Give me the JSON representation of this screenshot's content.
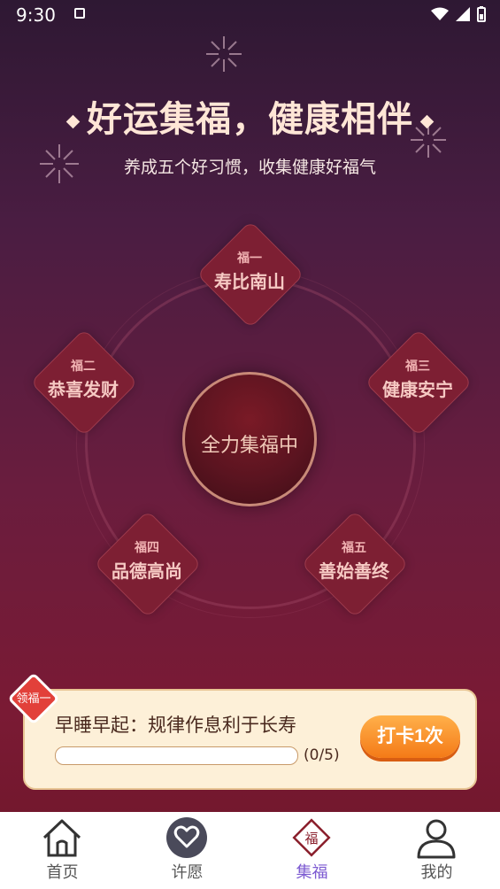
{
  "status_bar": {
    "time": "9:30"
  },
  "header": {
    "title": "好运集福，健康相伴",
    "subtitle": "养成五个好习惯，收集健康好福气"
  },
  "fu_cards": [
    {
      "num": "福一",
      "name": "寿比南山"
    },
    {
      "num": "福二",
      "name": "恭喜发财"
    },
    {
      "num": "福三",
      "name": "健康安宁"
    },
    {
      "num": "福四",
      "name": "品德高尚"
    },
    {
      "num": "福五",
      "name": "善始善终"
    }
  ],
  "center_button": {
    "label": "全力集福中"
  },
  "task": {
    "tag": "领福一",
    "text": "早睡早起：规律作息利于长寿",
    "progress_value": 0,
    "progress_total": 5,
    "progress_label": "(0/5)",
    "button_label": "打卡1次"
  },
  "tabs": [
    {
      "label": "首页",
      "icon": "home-icon"
    },
    {
      "label": "许愿",
      "icon": "heart-icon"
    },
    {
      "label": "集福",
      "icon": "fu-diamond-icon",
      "glyph": "福",
      "active": true
    },
    {
      "label": "我的",
      "icon": "person-icon"
    }
  ],
  "colors": {
    "accent": "#7c5ad1",
    "button": "#f47a17",
    "card_bg": "#fdf0d8",
    "fu_diamond": "#7d1f33"
  }
}
